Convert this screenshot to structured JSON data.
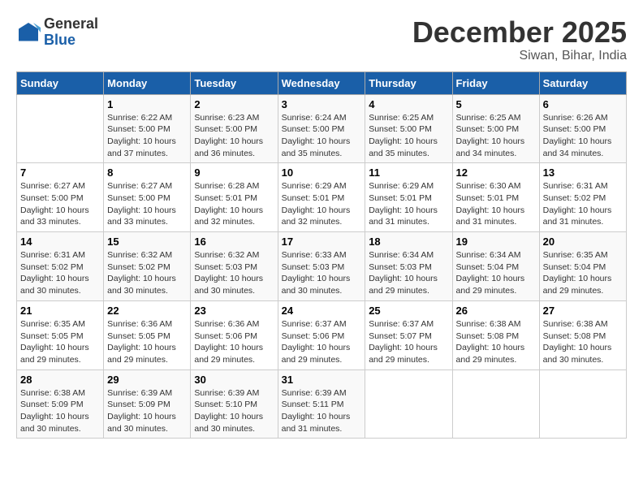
{
  "logo": {
    "general": "General",
    "blue": "Blue"
  },
  "header": {
    "month": "December 2025",
    "location": "Siwan, Bihar, India"
  },
  "days_of_week": [
    "Sunday",
    "Monday",
    "Tuesday",
    "Wednesday",
    "Thursday",
    "Friday",
    "Saturday"
  ],
  "weeks": [
    [
      {
        "day": "",
        "sunrise": "",
        "sunset": "",
        "daylight": ""
      },
      {
        "day": "1",
        "sunrise": "Sunrise: 6:22 AM",
        "sunset": "Sunset: 5:00 PM",
        "daylight": "Daylight: 10 hours and 37 minutes."
      },
      {
        "day": "2",
        "sunrise": "Sunrise: 6:23 AM",
        "sunset": "Sunset: 5:00 PM",
        "daylight": "Daylight: 10 hours and 36 minutes."
      },
      {
        "day": "3",
        "sunrise": "Sunrise: 6:24 AM",
        "sunset": "Sunset: 5:00 PM",
        "daylight": "Daylight: 10 hours and 35 minutes."
      },
      {
        "day": "4",
        "sunrise": "Sunrise: 6:25 AM",
        "sunset": "Sunset: 5:00 PM",
        "daylight": "Daylight: 10 hours and 35 minutes."
      },
      {
        "day": "5",
        "sunrise": "Sunrise: 6:25 AM",
        "sunset": "Sunset: 5:00 PM",
        "daylight": "Daylight: 10 hours and 34 minutes."
      },
      {
        "day": "6",
        "sunrise": "Sunrise: 6:26 AM",
        "sunset": "Sunset: 5:00 PM",
        "daylight": "Daylight: 10 hours and 34 minutes."
      }
    ],
    [
      {
        "day": "7",
        "sunrise": "Sunrise: 6:27 AM",
        "sunset": "Sunset: 5:00 PM",
        "daylight": "Daylight: 10 hours and 33 minutes."
      },
      {
        "day": "8",
        "sunrise": "Sunrise: 6:27 AM",
        "sunset": "Sunset: 5:00 PM",
        "daylight": "Daylight: 10 hours and 33 minutes."
      },
      {
        "day": "9",
        "sunrise": "Sunrise: 6:28 AM",
        "sunset": "Sunset: 5:01 PM",
        "daylight": "Daylight: 10 hours and 32 minutes."
      },
      {
        "day": "10",
        "sunrise": "Sunrise: 6:29 AM",
        "sunset": "Sunset: 5:01 PM",
        "daylight": "Daylight: 10 hours and 32 minutes."
      },
      {
        "day": "11",
        "sunrise": "Sunrise: 6:29 AM",
        "sunset": "Sunset: 5:01 PM",
        "daylight": "Daylight: 10 hours and 31 minutes."
      },
      {
        "day": "12",
        "sunrise": "Sunrise: 6:30 AM",
        "sunset": "Sunset: 5:01 PM",
        "daylight": "Daylight: 10 hours and 31 minutes."
      },
      {
        "day": "13",
        "sunrise": "Sunrise: 6:31 AM",
        "sunset": "Sunset: 5:02 PM",
        "daylight": "Daylight: 10 hours and 31 minutes."
      }
    ],
    [
      {
        "day": "14",
        "sunrise": "Sunrise: 6:31 AM",
        "sunset": "Sunset: 5:02 PM",
        "daylight": "Daylight: 10 hours and 30 minutes."
      },
      {
        "day": "15",
        "sunrise": "Sunrise: 6:32 AM",
        "sunset": "Sunset: 5:02 PM",
        "daylight": "Daylight: 10 hours and 30 minutes."
      },
      {
        "day": "16",
        "sunrise": "Sunrise: 6:32 AM",
        "sunset": "Sunset: 5:03 PM",
        "daylight": "Daylight: 10 hours and 30 minutes."
      },
      {
        "day": "17",
        "sunrise": "Sunrise: 6:33 AM",
        "sunset": "Sunset: 5:03 PM",
        "daylight": "Daylight: 10 hours and 30 minutes."
      },
      {
        "day": "18",
        "sunrise": "Sunrise: 6:34 AM",
        "sunset": "Sunset: 5:03 PM",
        "daylight": "Daylight: 10 hours and 29 minutes."
      },
      {
        "day": "19",
        "sunrise": "Sunrise: 6:34 AM",
        "sunset": "Sunset: 5:04 PM",
        "daylight": "Daylight: 10 hours and 29 minutes."
      },
      {
        "day": "20",
        "sunrise": "Sunrise: 6:35 AM",
        "sunset": "Sunset: 5:04 PM",
        "daylight": "Daylight: 10 hours and 29 minutes."
      }
    ],
    [
      {
        "day": "21",
        "sunrise": "Sunrise: 6:35 AM",
        "sunset": "Sunset: 5:05 PM",
        "daylight": "Daylight: 10 hours and 29 minutes."
      },
      {
        "day": "22",
        "sunrise": "Sunrise: 6:36 AM",
        "sunset": "Sunset: 5:05 PM",
        "daylight": "Daylight: 10 hours and 29 minutes."
      },
      {
        "day": "23",
        "sunrise": "Sunrise: 6:36 AM",
        "sunset": "Sunset: 5:06 PM",
        "daylight": "Daylight: 10 hours and 29 minutes."
      },
      {
        "day": "24",
        "sunrise": "Sunrise: 6:37 AM",
        "sunset": "Sunset: 5:06 PM",
        "daylight": "Daylight: 10 hours and 29 minutes."
      },
      {
        "day": "25",
        "sunrise": "Sunrise: 6:37 AM",
        "sunset": "Sunset: 5:07 PM",
        "daylight": "Daylight: 10 hours and 29 minutes."
      },
      {
        "day": "26",
        "sunrise": "Sunrise: 6:38 AM",
        "sunset": "Sunset: 5:08 PM",
        "daylight": "Daylight: 10 hours and 29 minutes."
      },
      {
        "day": "27",
        "sunrise": "Sunrise: 6:38 AM",
        "sunset": "Sunset: 5:08 PM",
        "daylight": "Daylight: 10 hours and 30 minutes."
      }
    ],
    [
      {
        "day": "28",
        "sunrise": "Sunrise: 6:38 AM",
        "sunset": "Sunset: 5:09 PM",
        "daylight": "Daylight: 10 hours and 30 minutes."
      },
      {
        "day": "29",
        "sunrise": "Sunrise: 6:39 AM",
        "sunset": "Sunset: 5:09 PM",
        "daylight": "Daylight: 10 hours and 30 minutes."
      },
      {
        "day": "30",
        "sunrise": "Sunrise: 6:39 AM",
        "sunset": "Sunset: 5:10 PM",
        "daylight": "Daylight: 10 hours and 30 minutes."
      },
      {
        "day": "31",
        "sunrise": "Sunrise: 6:39 AM",
        "sunset": "Sunset: 5:11 PM",
        "daylight": "Daylight: 10 hours and 31 minutes."
      },
      {
        "day": "",
        "sunrise": "",
        "sunset": "",
        "daylight": ""
      },
      {
        "day": "",
        "sunrise": "",
        "sunset": "",
        "daylight": ""
      },
      {
        "day": "",
        "sunrise": "",
        "sunset": "",
        "daylight": ""
      }
    ]
  ]
}
